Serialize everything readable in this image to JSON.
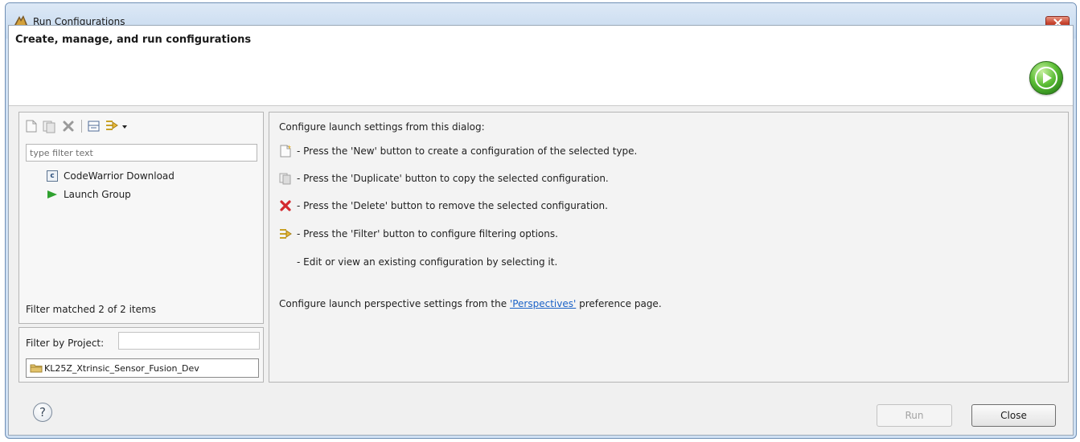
{
  "window": {
    "title": "Run Configurations"
  },
  "header": {
    "title": "Create, manage, and run configurations"
  },
  "left_panel": {
    "toolbar": [
      "new-config-icon",
      "duplicate-icon",
      "delete-icon",
      "collapse-all-icon",
      "filter-icon",
      "dropdown-arrow-icon"
    ],
    "filter_placeholder": "type filter text",
    "tree_items": [
      {
        "label": "CodeWarrior Download",
        "icon": "codewarrior-icon"
      },
      {
        "label": "Launch Group",
        "icon": "launch-group-icon"
      }
    ],
    "filter_status": "Filter matched 2 of 2 items",
    "filter_by_project_label": "Filter by Project:",
    "project_value": "KL25Z_Xtrinsic_Sensor_Fusion_Dev"
  },
  "right_panel": {
    "intro": "Configure launch settings from this dialog:",
    "lines": [
      {
        "icon": "new-config-icon",
        "text": "- Press the 'New' button to create a configuration of the selected type."
      },
      {
        "icon": "duplicate-icon",
        "text": "- Press the 'Duplicate' button to copy the selected configuration."
      },
      {
        "icon": "delete-icon",
        "text": "- Press the 'Delete' button to remove the selected configuration."
      },
      {
        "icon": "filter-icon",
        "text": "- Press the 'Filter' button to configure filtering options."
      },
      {
        "icon": "",
        "text": "- Edit or view an existing configuration by selecting it."
      }
    ],
    "perspectives_before": "Configure launch perspective settings from the ",
    "perspectives_link": "'Perspectives'",
    "perspectives_after": " preference page."
  },
  "buttons": {
    "run": "Run",
    "close": "Close",
    "help": "?"
  },
  "colors": {
    "link": "#1a62c7",
    "run_badge": "#5bbd35",
    "close_button": "#c7442f"
  }
}
